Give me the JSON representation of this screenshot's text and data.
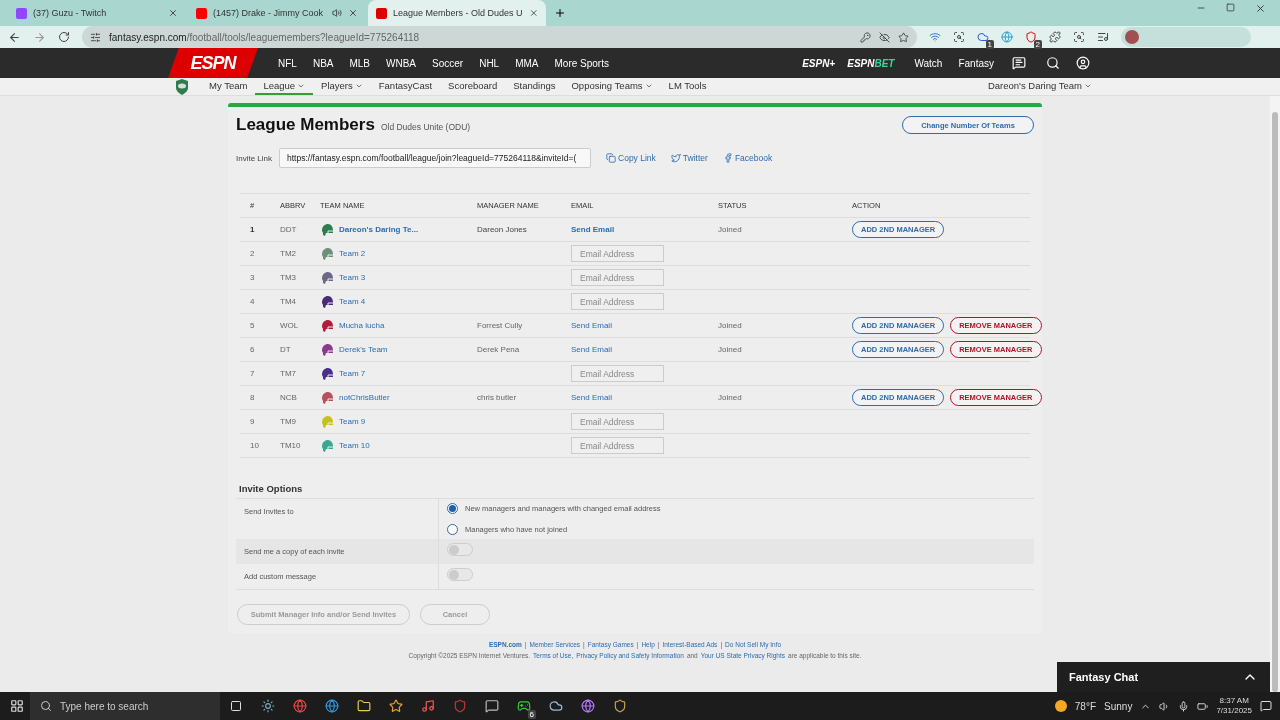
{
  "browser": {
    "tabs": [
      {
        "title": "(37) Guzu - Twitch",
        "audio": false,
        "selected": false
      },
      {
        "title": "(1457) Drake - Jimmy Cook",
        "audio": true,
        "selected": false
      },
      {
        "title": "League Members - Old Dudes U",
        "audio": false,
        "selected": true
      }
    ],
    "url_host": "fantasy.espn.com",
    "url_path": "/football/tools/leaguemembers?leagueId=775264118",
    "extension_badges": [
      "1",
      "2"
    ]
  },
  "espn_nav": {
    "logo": "ESPN",
    "sports": [
      "NFL",
      "NBA",
      "MLB",
      "WNBA",
      "Soccer",
      "NHL",
      "MMA",
      "More Sports"
    ],
    "brand_plus": "ESPN+",
    "brand_bet_a": "ESPN",
    "brand_bet_b": "BET",
    "links": [
      "Watch",
      "Fantasy"
    ]
  },
  "sub_nav": {
    "items": [
      {
        "label": "My Team",
        "caret": false,
        "selected": false
      },
      {
        "label": "League",
        "caret": true,
        "selected": true
      },
      {
        "label": "Players",
        "caret": true,
        "selected": false
      },
      {
        "label": "FantasyCast",
        "caret": false,
        "selected": false
      },
      {
        "label": "Scoreboard",
        "caret": false,
        "selected": false
      },
      {
        "label": "Standings",
        "caret": false,
        "selected": false
      },
      {
        "label": "Opposing Teams",
        "caret": true,
        "selected": false
      },
      {
        "label": "LM Tools",
        "caret": false,
        "selected": false
      }
    ],
    "team_menu": "Dareon's Daring Team"
  },
  "page": {
    "title": "League Members",
    "league": "Old Dudes Unite (ODU)",
    "change_button": "Change Number Of Teams",
    "invite_label": "Invite Link",
    "invite_link": "https://fantasy.espn.com/football/league/join?leagueId=775264118&inviteId=(",
    "share": [
      {
        "label": "Copy Link",
        "kind": "copy"
      },
      {
        "label": "Twitter",
        "kind": "twitter"
      },
      {
        "label": "Facebook",
        "kind": "facebook"
      }
    ]
  },
  "table": {
    "columns": [
      "#",
      "ABBRV",
      "TEAM NAME",
      "MANAGER NAME",
      "EMAIL",
      "STATUS",
      "ACTION"
    ],
    "rows": [
      {
        "num": "1",
        "abbrv": "DDT",
        "team": "Dareon's Daring Te...",
        "color": "#2e7d4f",
        "own": true,
        "manager": "Dareon Jones",
        "email": {
          "kind": "link",
          "text": "Send Email"
        },
        "status": "Joined",
        "actions": [
          {
            "label": "ADD 2ND MANAGER",
            "kind": "add"
          }
        ]
      },
      {
        "num": "2",
        "abbrv": "TM2",
        "team": "Team 2",
        "color": "#6f8f78",
        "own": false,
        "email": {
          "kind": "input",
          "placeholder": "Email Address"
        },
        "actions": []
      },
      {
        "num": "3",
        "abbrv": "TM3",
        "team": "Team 3",
        "color": "#6b6888",
        "own": false,
        "email": {
          "kind": "input",
          "placeholder": "Email Address"
        },
        "actions": []
      },
      {
        "num": "4",
        "abbrv": "TM4",
        "team": "Team 4",
        "color": "#4b2a7a",
        "own": false,
        "email": {
          "kind": "input",
          "placeholder": "Email Address"
        },
        "actions": []
      },
      {
        "num": "5",
        "abbrv": "WOL",
        "team": "Mucha lucha",
        "color": "#b01e3a",
        "own": false,
        "manager": "Forrest Cully",
        "email": {
          "kind": "link",
          "text": "Send Email"
        },
        "status": "Joined",
        "actions": [
          {
            "label": "ADD 2ND MANAGER",
            "kind": "add"
          },
          {
            "label": "REMOVE MANAGER",
            "kind": "remove"
          }
        ]
      },
      {
        "num": "6",
        "abbrv": "DT",
        "team": "Derek's Team",
        "color": "#8e3a8a",
        "own": false,
        "manager": "Derek Pena",
        "email": {
          "kind": "link",
          "text": "Send Email"
        },
        "status": "Joined",
        "actions": [
          {
            "label": "ADD 2ND MANAGER",
            "kind": "add"
          },
          {
            "label": "REMOVE MANAGER",
            "kind": "remove"
          }
        ]
      },
      {
        "num": "7",
        "abbrv": "TM7",
        "team": "Team 7",
        "color": "#4a2f8a",
        "own": false,
        "email": {
          "kind": "input",
          "placeholder": "Email Address"
        },
        "actions": []
      },
      {
        "num": "8",
        "abbrv": "NCB",
        "team": "notChrisButler",
        "color": "#b5525a",
        "own": false,
        "manager": "chris butler",
        "email": {
          "kind": "link",
          "text": "Send Email"
        },
        "status": "Joined",
        "actions": [
          {
            "label": "ADD 2ND MANAGER",
            "kind": "add"
          },
          {
            "label": "REMOVE MANAGER",
            "kind": "remove"
          }
        ]
      },
      {
        "num": "9",
        "abbrv": "TM9",
        "team": "Team 9",
        "color": "#c8c020",
        "own": false,
        "email": {
          "kind": "input",
          "placeholder": "Email Address"
        },
        "actions": []
      },
      {
        "num": "10",
        "abbrv": "TM10",
        "team": "Team 10",
        "color": "#3aa88f",
        "own": false,
        "email": {
          "kind": "input",
          "placeholder": "Email Address"
        },
        "actions": []
      }
    ]
  },
  "invite_options": {
    "title": "Invite Options",
    "send_to_label": "Send Invites to",
    "radios": [
      {
        "label": "New managers and managers with changed email address",
        "selected": true
      },
      {
        "label": "Managers who have not joined",
        "selected": false
      }
    ],
    "toggles": [
      {
        "label": "Send me a copy of each invite",
        "on": false
      },
      {
        "label": "Add custom message",
        "on": false
      }
    ]
  },
  "actions": [
    {
      "label": "Submit Manager Info and/or Send Invites",
      "disabled": true
    },
    {
      "label": "Cancel",
      "disabled": true
    }
  ],
  "footer": {
    "links": [
      {
        "text": "ESPN.com",
        "bold": true
      },
      {
        "text": "Member Services",
        "bold": false
      },
      {
        "text": "Fantasy Games",
        "bold": false
      },
      {
        "text": "Help",
        "bold": false
      },
      {
        "text": "Interest-Based Ads",
        "bold": false
      },
      {
        "text": "Do Not Sell My Info",
        "bold": false
      }
    ],
    "separator": "|",
    "copyright": [
      {
        "text": "Copyright ©2025 ESPN Internet Ventures.",
        "link": false
      },
      {
        "text": "Terms of Use,",
        "link": true
      },
      {
        "text": "Privacy Policy and Safety Information",
        "link": true
      },
      {
        "text": "and",
        "link": false
      },
      {
        "text": "Your US State Privacy Rights",
        "link": true
      },
      {
        "text": "are applicable to this site.",
        "link": false
      }
    ]
  },
  "chat": {
    "title": "Fantasy Chat"
  },
  "taskbar": {
    "search_placeholder": "Type here to search",
    "xbox_badge": "6",
    "temperature": "78°F",
    "weather": "Sunny",
    "time": "8:37 AM",
    "date": "7/31/2025"
  }
}
